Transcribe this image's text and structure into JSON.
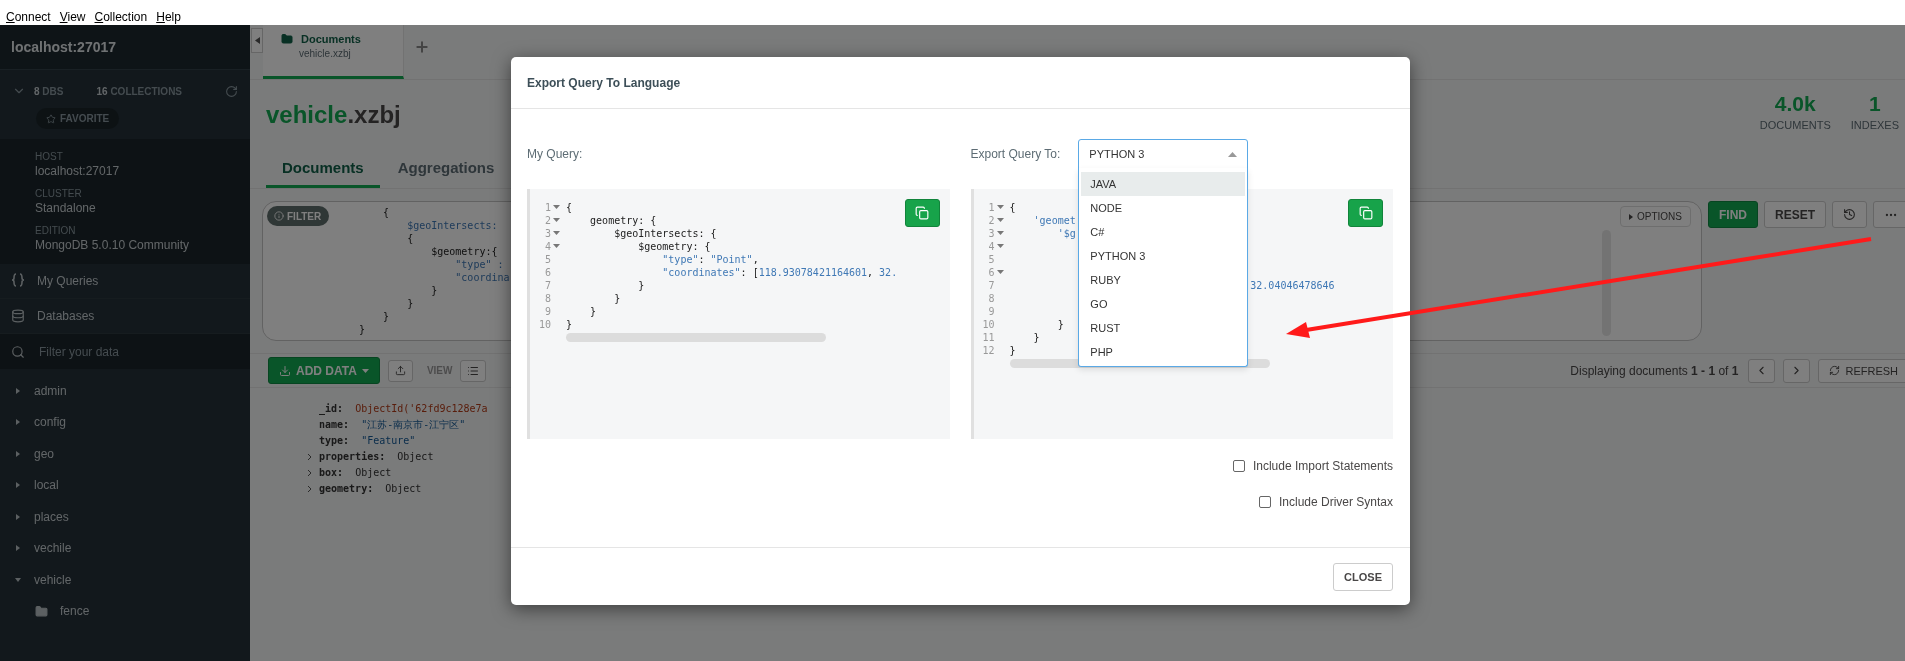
{
  "menu": [
    "Connect",
    "View",
    "Collection",
    "Help"
  ],
  "sidebar": {
    "connection": "localhost:27017",
    "dbs_count": "8",
    "dbs_label": "DBS",
    "collections_count": "16",
    "collections_label": "COLLECTIONS",
    "favorite": "FAVORITE",
    "info": [
      {
        "label": "HOST",
        "value": "localhost:27017"
      },
      {
        "label": "CLUSTER",
        "value": "Standalone"
      },
      {
        "label": "EDITION",
        "value": "MongoDB 5.0.10 Community"
      }
    ],
    "nav": [
      {
        "kind": "queries",
        "label": "My Queries"
      },
      {
        "kind": "databases",
        "label": "Databases"
      }
    ],
    "filter_placeholder": "Filter your data",
    "databases": [
      {
        "name": "admin",
        "expanded": false
      },
      {
        "name": "config",
        "expanded": false
      },
      {
        "name": "geo",
        "expanded": false
      },
      {
        "name": "local",
        "expanded": false
      },
      {
        "name": "places",
        "expanded": false
      },
      {
        "name": "vechile",
        "expanded": false
      },
      {
        "name": "vehicle",
        "expanded": true,
        "children": [
          {
            "name": "fence"
          }
        ]
      }
    ]
  },
  "tab": {
    "title": "Documents",
    "subtitle": "vehicle.xzbj",
    "selected": true
  },
  "header": {
    "db": "vehicle",
    "collection": ".xzbj",
    "stats": [
      {
        "value": "4.0k",
        "label": "DOCUMENTS"
      },
      {
        "value": "1",
        "label": "INDEXES"
      }
    ]
  },
  "subtabs": [
    {
      "label": "Documents",
      "selected": true
    },
    {
      "label": "Aggregations",
      "selected": false
    }
  ],
  "query_bar": {
    "filter_label": "FILTER",
    "filter_lines": [
      [
        {
          "kind": "plain",
          "text": "    {"
        }
      ],
      [
        {
          "kind": "key",
          "text": "        $geoIntersects:"
        }
      ],
      [
        {
          "kind": "plain",
          "text": "        {"
        }
      ],
      [
        {
          "kind": "plain",
          "text": "            $geometry:{"
        }
      ],
      [
        {
          "kind": "string",
          "text": "                \"type\" :"
        }
      ],
      [
        {
          "kind": "string",
          "text": "                \"coordina"
        }
      ],
      [
        {
          "kind": "plain",
          "text": "            }"
        }
      ],
      [
        {
          "kind": "plain",
          "text": "        }"
        }
      ],
      [
        {
          "kind": "plain",
          "text": "    }"
        }
      ],
      [
        {
          "kind": "plain",
          "text": "}"
        }
      ]
    ],
    "options": "OPTIONS",
    "find": "FIND",
    "reset": "RESET"
  },
  "toolbar": {
    "add_data": "ADD DATA",
    "view": "VIEW",
    "displaying": "Displaying documents **1 - 1** of **1**",
    "refresh": "REFRESH"
  },
  "document": {
    "fields": [
      {
        "key": "_id:",
        "value": "ObjectId('62fd9c128e7a",
        "kind": "objectid",
        "expandable": false
      },
      {
        "key": "name:",
        "value": "\"江苏-南京市-江宁区\"",
        "kind": "string",
        "expandable": false
      },
      {
        "key": "type:",
        "value": "\"Feature\"",
        "kind": "string",
        "expandable": false
      },
      {
        "key": "properties:",
        "value": "Object",
        "kind": "object",
        "expandable": true
      },
      {
        "key": "box:",
        "value": "Object",
        "kind": "object",
        "expandable": true
      },
      {
        "key": "geometry:",
        "value": "Object",
        "kind": "object",
        "expandable": true
      }
    ]
  },
  "modal": {
    "title": "Export Query To Language",
    "my_query_label": "My Query:",
    "export_label": "Export Query To:",
    "select": {
      "value": "PYTHON 3",
      "open": true,
      "options": [
        {
          "label": "JAVA",
          "highlighted": true
        },
        {
          "label": "NODE",
          "highlighted": false
        },
        {
          "label": "C#",
          "highlighted": false
        },
        {
          "label": "PYTHON 3",
          "highlighted": false
        },
        {
          "label": "RUBY",
          "highlighted": false
        },
        {
          "label": "GO",
          "highlighted": false
        },
        {
          "label": "RUST",
          "highlighted": false
        },
        {
          "label": "PHP",
          "highlighted": false
        }
      ]
    },
    "input_code": [
      {
        "num": "1",
        "fold": true,
        "tokens": [
          {
            "kind": "plain",
            "text": "{"
          }
        ]
      },
      {
        "num": "2",
        "fold": true,
        "tokens": [
          {
            "kind": "plain",
            "text": "    geometry: {"
          }
        ]
      },
      {
        "num": "3",
        "fold": true,
        "tokens": [
          {
            "kind": "plain",
            "text": "        $geoIntersects: {"
          }
        ]
      },
      {
        "num": "4",
        "fold": true,
        "tokens": [
          {
            "kind": "plain",
            "text": "            $geometry: {"
          }
        ]
      },
      {
        "num": "5",
        "fold": false,
        "tokens": [
          {
            "kind": "string",
            "text": "                \"type\""
          },
          {
            "kind": "plain",
            "text": ": "
          },
          {
            "kind": "string",
            "text": "\"Point\""
          },
          {
            "kind": "plain",
            "text": ","
          }
        ]
      },
      {
        "num": "6",
        "fold": false,
        "tokens": [
          {
            "kind": "string",
            "text": "                \"coordinates\""
          },
          {
            "kind": "plain",
            "text": ": ["
          },
          {
            "kind": "string",
            "text": "118.93078421164601"
          },
          {
            "kind": "plain",
            "text": ", "
          },
          {
            "kind": "string",
            "text": "32."
          }
        ]
      },
      {
        "num": "7",
        "fold": false,
        "tokens": [
          {
            "kind": "plain",
            "text": "            }"
          }
        ]
      },
      {
        "num": "8",
        "fold": false,
        "tokens": [
          {
            "kind": "plain",
            "text": "        }"
          }
        ]
      },
      {
        "num": "9",
        "fold": false,
        "tokens": [
          {
            "kind": "plain",
            "text": "    }"
          }
        ]
      },
      {
        "num": "10",
        "fold": false,
        "tokens": [
          {
            "kind": "plain",
            "text": "}"
          }
        ]
      }
    ],
    "output_code": [
      {
        "num": "1",
        "fold": true,
        "tokens": [
          {
            "kind": "plain",
            "text": "{"
          }
        ]
      },
      {
        "num": "2",
        "fold": true,
        "tokens": [
          {
            "kind": "string",
            "text": "    'geomet"
          }
        ]
      },
      {
        "num": "3",
        "fold": true,
        "tokens": [
          {
            "kind": "string",
            "text": "        '$g"
          }
        ]
      },
      {
        "num": "4",
        "fold": true
      },
      {
        "num": "5",
        "fold": false
      },
      {
        "num": "6",
        "fold": true
      },
      {
        "num": "7",
        "fold": false,
        "tokens": [
          {
            "kind": "tail",
            "text": "32.04046478646"
          }
        ]
      },
      {
        "num": "8",
        "fold": false
      },
      {
        "num": "9",
        "fold": false
      },
      {
        "num": "10",
        "fold": false,
        "tokens": [
          {
            "kind": "plain",
            "text": "        }"
          }
        ]
      },
      {
        "num": "11",
        "fold": false,
        "tokens": [
          {
            "kind": "plain",
            "text": "    }"
          }
        ]
      },
      {
        "num": "12",
        "fold": false,
        "tokens": [
          {
            "kind": "plain",
            "text": "}"
          }
        ]
      }
    ],
    "checkboxes": [
      {
        "label": "Include Import Statements",
        "checked": false
      },
      {
        "label": "Include Driver Syntax",
        "checked": false
      }
    ],
    "close": "CLOSE"
  }
}
